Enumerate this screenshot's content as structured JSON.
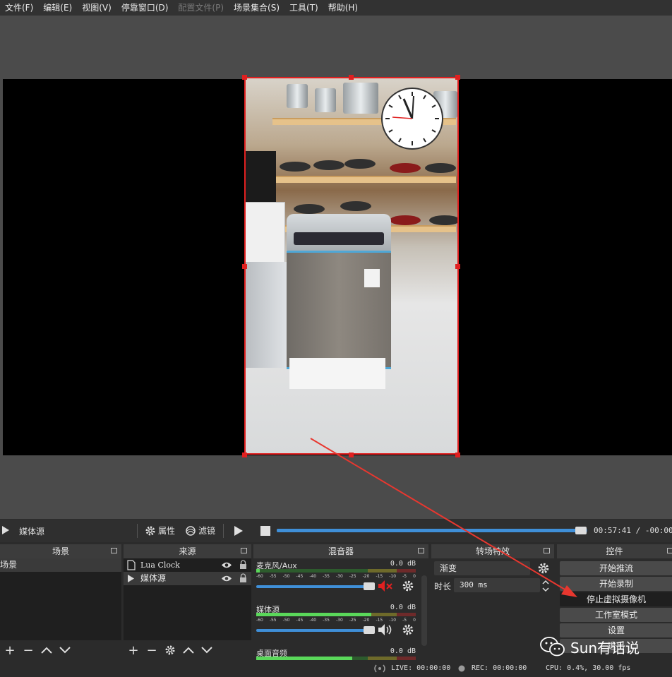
{
  "menu": {
    "items": [
      {
        "label": "文件(F)",
        "disabled": false
      },
      {
        "label": "编辑(E)",
        "disabled": false
      },
      {
        "label": "视图(V)",
        "disabled": false
      },
      {
        "label": "停靠窗口(D)",
        "disabled": false
      },
      {
        "label": "配置文件(P)",
        "disabled": true
      },
      {
        "label": "场景集合(S)",
        "disabled": false
      },
      {
        "label": "工具(T)",
        "disabled": false
      },
      {
        "label": "帮助(H)",
        "disabled": false
      }
    ]
  },
  "transport": {
    "source_name": "媒体源",
    "properties_label": "属性",
    "filters_label": "滤镜",
    "progress": 0.98,
    "time": "00:57:41 / -00:00:0"
  },
  "docks": {
    "scenes": {
      "title": "场景",
      "items": [
        "场景"
      ]
    },
    "sources": {
      "title": "来源",
      "items": [
        {
          "name": "Lua Clock",
          "icon": "text-file-icon"
        },
        {
          "name": "媒体源",
          "icon": "play-icon"
        }
      ]
    },
    "mixer": {
      "title": "混音器",
      "ticks": [
        "-60",
        "-55",
        "-50",
        "-45",
        "-40",
        "-35",
        "-30",
        "-25",
        "-20",
        "-15",
        "-10",
        "-5",
        "0"
      ],
      "channels": [
        {
          "name": "麦克风/Aux",
          "db": "0.0 dB",
          "muted": true,
          "level": 0.02,
          "volume": 1.0
        },
        {
          "name": "媒体源",
          "db": "0.0 dB",
          "muted": false,
          "level": 0.72,
          "volume": 1.0
        },
        {
          "name": "桌面音频",
          "db": "0.0 dB",
          "muted": false,
          "level": 0.6,
          "volume": 1.0
        }
      ]
    },
    "transitions": {
      "title": "转场特效",
      "transition": "渐变",
      "duration_label": "时长",
      "duration_value": "300 ms"
    },
    "controls": {
      "title": "控件",
      "buttons": [
        "开始推流",
        "开始录制",
        "停止虚拟摄像机",
        "工作室模式",
        "设置",
        "退出"
      ]
    }
  },
  "status": {
    "live": "LIVE: 00:00:00",
    "rec": "REC: 00:00:00",
    "cpu": "CPU: 0.4%, 30.00 fps"
  },
  "watermark": {
    "text": "Sun有话说"
  },
  "colors": {
    "accent": "#3f8fd8",
    "selection": "#e02020",
    "annotation_arrow": "#e8372f"
  }
}
